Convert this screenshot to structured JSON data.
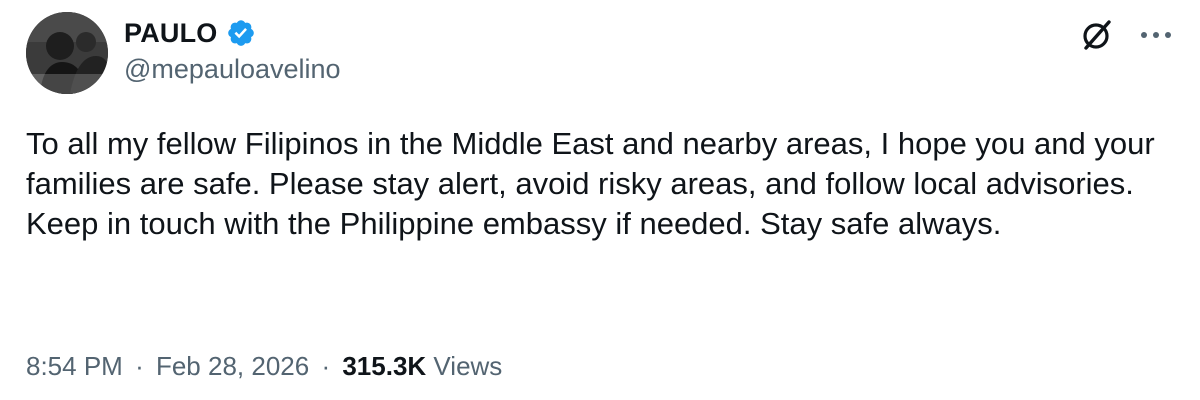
{
  "author": {
    "display_name": "PAULO",
    "handle": "@mepauloavelino",
    "verified": true,
    "verified_color": "#1d9bf0"
  },
  "header_icons": {
    "grok": "grok-icon",
    "more": "more-horizontal-icon"
  },
  "tweet": {
    "text": "To all my fellow Filipinos in the Middle East and nearby areas, I hope you and your families are safe. Please stay alert, avoid risky areas, and follow local advisories. Keep in touch with the Philippine embassy if needed. Stay safe always."
  },
  "meta": {
    "time": "8:54 PM",
    "separator": "·",
    "date": "Feb 28, 2026",
    "views_count": "315.3K",
    "views_label": "Views"
  },
  "colors": {
    "text_primary": "#0f1419",
    "text_secondary": "#536471",
    "accent": "#1d9bf0"
  }
}
